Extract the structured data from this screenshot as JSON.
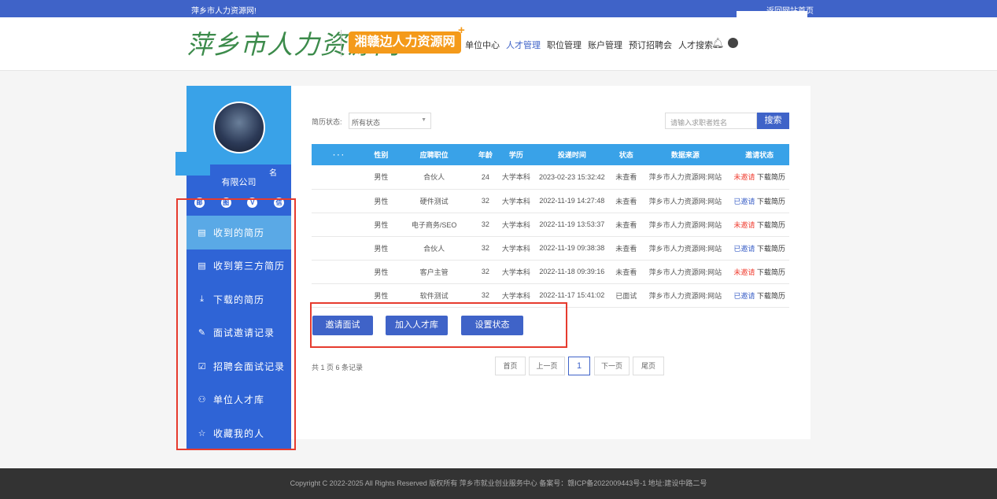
{
  "topbar": {
    "site_name": "萍乡市人力资源网!",
    "home_link": "返回网站首页"
  },
  "header": {
    "logo_text": "萍乡市人力资源网",
    "badge_text": "湘赣边人力资源网",
    "badge_plus": "+",
    "nav": [
      {
        "label": "单位中心",
        "active": false
      },
      {
        "label": "人才管理",
        "active": true
      },
      {
        "label": "职位管理",
        "active": false
      },
      {
        "label": "账户管理",
        "active": false
      },
      {
        "label": "预订招聘会",
        "active": false
      },
      {
        "label": "人才搜索",
        "active": false
      }
    ]
  },
  "sidebar": {
    "company_suffix": "有限公司",
    "company_tail": "名",
    "icons": [
      "邮",
      "图",
      "V",
      "信"
    ],
    "menu": [
      {
        "icon": "▤",
        "label": "收到的简历",
        "active": true
      },
      {
        "icon": "▤",
        "label": "收到第三方简历",
        "active": false
      },
      {
        "icon": "⤓",
        "label": "下载的简历",
        "active": false
      },
      {
        "icon": "✎",
        "label": "面试邀请记录",
        "active": false
      },
      {
        "icon": "☑",
        "label": "招聘会面试记录",
        "active": false
      },
      {
        "icon": "⚇",
        "label": "单位人才库",
        "active": false
      },
      {
        "icon": "☆",
        "label": "收藏我的人",
        "active": false
      }
    ]
  },
  "filter": {
    "status_label": "简历状态:",
    "status_value": "所有状态",
    "search_placeholder": "请输入求职者姓名",
    "search_button": "搜索"
  },
  "table": {
    "headers": [
      "· · ·",
      "性别",
      "应聘职位",
      "年龄",
      "学历",
      "投递时间",
      "状态",
      "数据来源",
      "邀请状态"
    ],
    "rows": [
      {
        "first": "",
        "gender": "男性",
        "position": "合伙人",
        "age": "24",
        "edu": "大学本科",
        "time": "2023-02-23 15:32:42",
        "status": "未查看",
        "status_color": "red",
        "source": "萍乡市人力资源网:网站",
        "invite": "未邀请",
        "invite_color": "red",
        "download": "下载简历"
      },
      {
        "first": "",
        "gender": "男性",
        "position": "硬件测试",
        "age": "32",
        "edu": "大学本科",
        "time": "2022-11-19 14:27:48",
        "status": "未查看",
        "status_color": "red",
        "source": "萍乡市人力资源网:网站",
        "invite": "已邀请",
        "invite_color": "blue",
        "download": "下载简历"
      },
      {
        "first": "",
        "gender": "男性",
        "position": "电子商务/SEO",
        "age": "32",
        "edu": "大学本科",
        "time": "2022-11-19 13:53:37",
        "status": "未查看",
        "status_color": "red",
        "source": "萍乡市人力资源网:网站",
        "invite": "未邀请",
        "invite_color": "red",
        "download": "下载简历"
      },
      {
        "first": "",
        "gender": "男性",
        "position": "合伙人",
        "age": "32",
        "edu": "大学本科",
        "time": "2022-11-19 09:38:38",
        "status": "未查看",
        "status_color": "red",
        "source": "萍乡市人力资源网:网站",
        "invite": "已邀请",
        "invite_color": "blue",
        "download": "下载简历"
      },
      {
        "first": "",
        "gender": "男性",
        "position": "客户主管",
        "age": "32",
        "edu": "大学本科",
        "time": "2022-11-18 09:39:16",
        "status": "未查看",
        "status_color": "red",
        "source": "萍乡市人力资源网:网站",
        "invite": "未邀请",
        "invite_color": "red",
        "download": "下载简历"
      },
      {
        "first": "",
        "gender": "男性",
        "position": "软件测试",
        "age": "32",
        "edu": "大学本科",
        "time": "2022-11-17 15:41:02",
        "status": "已面试",
        "status_color": "blue",
        "source": "萍乡市人力资源网:网站",
        "invite": "已邀请",
        "invite_color": "blue",
        "download": "下载简历"
      }
    ]
  },
  "actions": {
    "invite": "邀请面试",
    "add_pool": "加入人才库",
    "set_status": "设置状态"
  },
  "pagination": {
    "info": "共 1 页 6 条记录",
    "first": "首页",
    "prev": "上一页",
    "current": "1",
    "next": "下一页",
    "last": "尾页"
  },
  "footer": {
    "text": "Copyright C 2022-2025 All Rights Reserved 版权所有 萍乡市就业创业服务中心 备案号：赣ICP备2022009443号-1 地址:建设中路二号"
  }
}
